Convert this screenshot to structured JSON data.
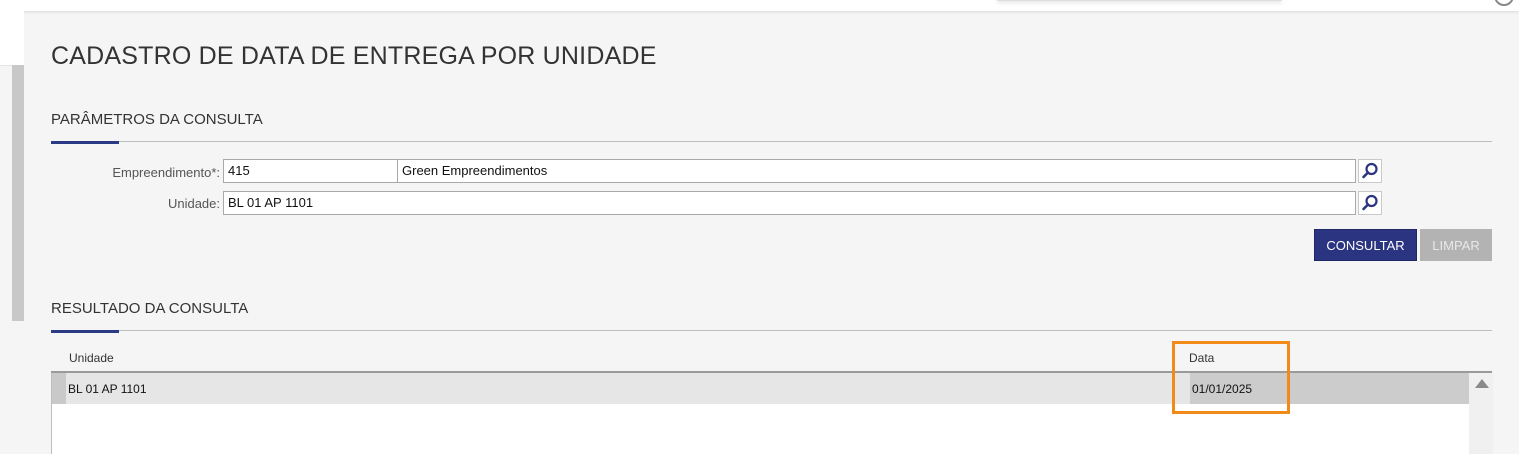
{
  "page": {
    "title": "CADASTRO DE DATA DE ENTREGA POR UNIDADE"
  },
  "parameters": {
    "section_title": "PARÂMETROS DA CONSULTA",
    "empreendimento": {
      "label": "Empreendimento*:",
      "code": "415",
      "name": "Green Empreendimentos"
    },
    "unidade": {
      "label": "Unidade:",
      "value": "BL 01 AP 1101"
    },
    "lookup_icon": "search-icon",
    "buttons": {
      "consultar": "CONSULTAR",
      "limpar": "LIMPAR"
    }
  },
  "results": {
    "section_title": "RESULTADO DA CONSULTA",
    "columns": [
      "Unidade",
      "Data"
    ],
    "rows": [
      {
        "unidade": "BL 01 AP 1101",
        "data": "01/01/2025"
      }
    ]
  },
  "colors": {
    "accent": "#2a3480",
    "highlight": "#f28a1a",
    "disabled": "#b3b3b3"
  }
}
